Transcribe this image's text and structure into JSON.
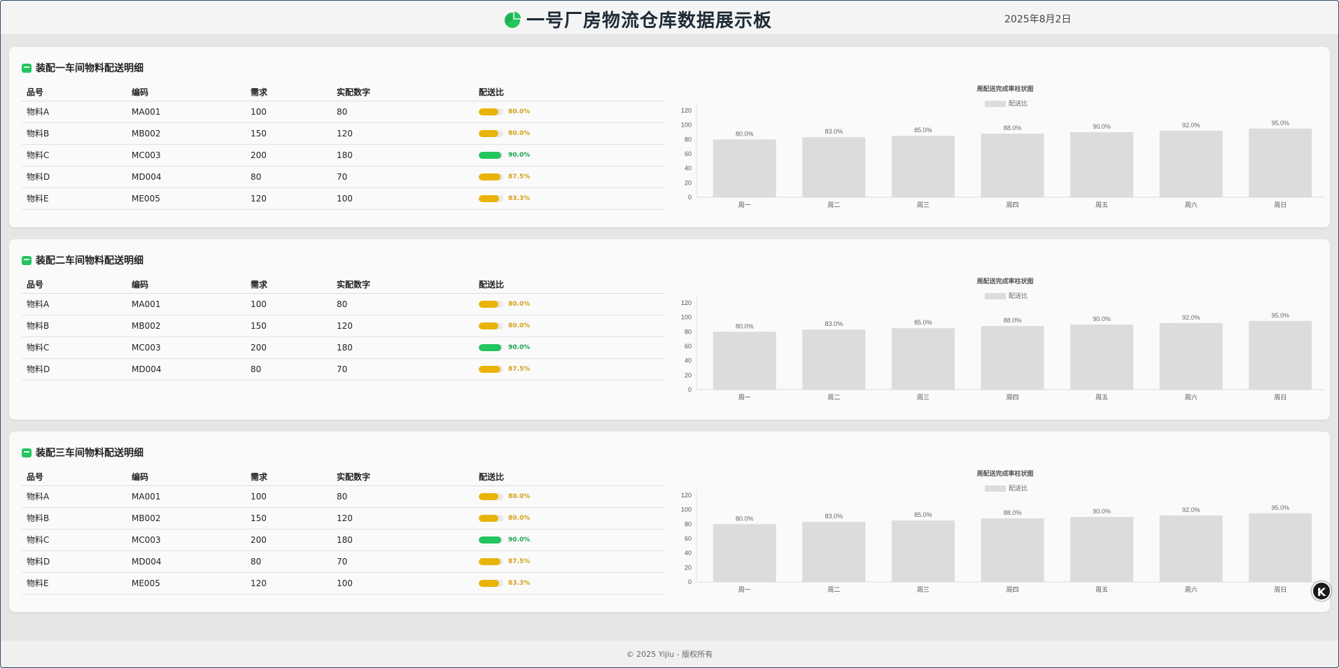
{
  "header": {
    "title": "一号厂房物流仓库数据展示板",
    "date": "2025年8月2日"
  },
  "columns": [
    "品号",
    "编码",
    "需求",
    "实配数字",
    "配送比"
  ],
  "panels": [
    {
      "title": "装配一车间物料配送明细",
      "rows": [
        {
          "name": "物料A",
          "code": "MA001",
          "need": "100",
          "actual": "80",
          "ratio": 0.8,
          "ratio_text": "80.0%"
        },
        {
          "name": "物料B",
          "code": "MB002",
          "need": "150",
          "actual": "120",
          "ratio": 0.8,
          "ratio_text": "80.0%"
        },
        {
          "name": "物料C",
          "code": "MC003",
          "need": "200",
          "actual": "180",
          "ratio": 0.9,
          "ratio_text": "90.0%"
        },
        {
          "name": "物料D",
          "code": "MD004",
          "need": "80",
          "actual": "70",
          "ratio": 0.875,
          "ratio_text": "87.5%"
        },
        {
          "name": "物料E",
          "code": "ME005",
          "need": "120",
          "actual": "100",
          "ratio": 0.833,
          "ratio_text": "83.3%"
        }
      ]
    },
    {
      "title": "装配二车间物料配送明细",
      "rows": [
        {
          "name": "物料A",
          "code": "MA001",
          "need": "100",
          "actual": "80",
          "ratio": 0.8,
          "ratio_text": "80.0%"
        },
        {
          "name": "物料B",
          "code": "MB002",
          "need": "150",
          "actual": "120",
          "ratio": 0.8,
          "ratio_text": "80.0%"
        },
        {
          "name": "物料C",
          "code": "MC003",
          "need": "200",
          "actual": "180",
          "ratio": 0.9,
          "ratio_text": "90.0%"
        },
        {
          "name": "物料D",
          "code": "MD004",
          "need": "80",
          "actual": "70",
          "ratio": 0.875,
          "ratio_text": "87.5%"
        }
      ]
    },
    {
      "title": "装配三车间物料配送明细",
      "rows": [
        {
          "name": "物料A",
          "code": "MA001",
          "need": "100",
          "actual": "80",
          "ratio": 0.8,
          "ratio_text": "80.0%"
        },
        {
          "name": "物料B",
          "code": "MB002",
          "need": "150",
          "actual": "120",
          "ratio": 0.8,
          "ratio_text": "80.0%"
        },
        {
          "name": "物料C",
          "code": "MC003",
          "need": "200",
          "actual": "180",
          "ratio": 0.9,
          "ratio_text": "90.0%"
        },
        {
          "name": "物料D",
          "code": "MD004",
          "need": "80",
          "actual": "70",
          "ratio": 0.875,
          "ratio_text": "87.5%"
        },
        {
          "name": "物料E",
          "code": "ME005",
          "need": "120",
          "actual": "100",
          "ratio": 0.833,
          "ratio_text": "83.3%"
        }
      ]
    }
  ],
  "chart_data": [
    {
      "type": "bar",
      "title": "周配送完成率柱状图",
      "categories": [
        "周一",
        "周二",
        "周三",
        "周四",
        "周五",
        "周六",
        "周日"
      ],
      "series": [
        {
          "name": "配送比",
          "values": [
            80,
            83,
            85,
            88,
            90,
            92,
            95
          ]
        }
      ],
      "data_labels": [
        "80.0%",
        "83.0%",
        "85.0%",
        "88.0%",
        "90.0%",
        "92.0%",
        "95.0%"
      ],
      "ylim": [
        0,
        120
      ],
      "yticks": [
        0,
        20,
        40,
        60,
        80,
        100,
        120
      ],
      "legend": "top",
      "bar_color": "#dcdcdc"
    },
    {
      "type": "bar",
      "title": "周配送完成率柱状图",
      "categories": [
        "周一",
        "周二",
        "周三",
        "周四",
        "周五",
        "周六",
        "周日"
      ],
      "series": [
        {
          "name": "配送比",
          "values": [
            80,
            83,
            85,
            88,
            90,
            92,
            95
          ]
        }
      ],
      "data_labels": [
        "80.0%",
        "83.0%",
        "85.0%",
        "88.0%",
        "90.0%",
        "92.0%",
        "95.0%"
      ],
      "ylim": [
        0,
        120
      ],
      "yticks": [
        0,
        20,
        40,
        60,
        80,
        100,
        120
      ],
      "legend": "top",
      "bar_color": "#dcdcdc"
    },
    {
      "type": "bar",
      "title": "周配送完成率柱状图",
      "categories": [
        "周一",
        "周二",
        "周三",
        "周四",
        "周五",
        "周六",
        "周日"
      ],
      "series": [
        {
          "name": "配送比",
          "values": [
            80,
            83,
            85,
            88,
            90,
            92,
            95
          ]
        }
      ],
      "data_labels": [
        "80.0%",
        "83.0%",
        "85.0%",
        "88.0%",
        "90.0%",
        "92.0%",
        "95.0%"
      ],
      "ylim": [
        0,
        120
      ],
      "yticks": [
        0,
        20,
        40,
        60,
        80,
        100,
        120
      ],
      "legend": "top",
      "bar_color": "#dcdcdc"
    }
  ],
  "footer": {
    "text": "© 2025 Yijiu - 版权所有"
  },
  "floating_button": {
    "label": "K"
  }
}
